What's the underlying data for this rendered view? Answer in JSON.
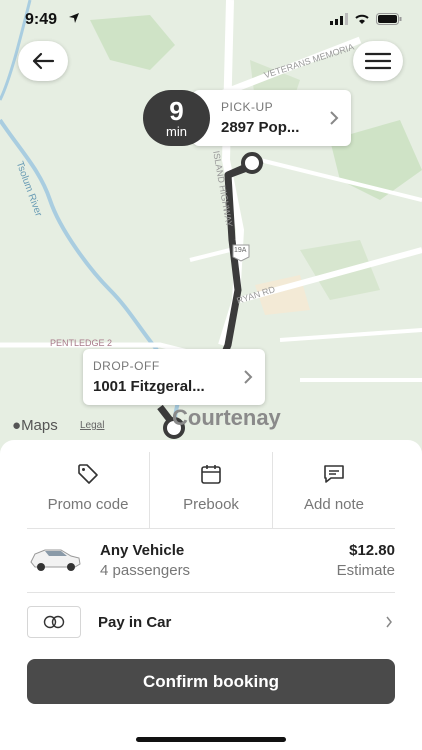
{
  "status_bar": {
    "time": "9:49"
  },
  "map": {
    "labels": {
      "river": "Tsolum River",
      "road1": "VETERANS MEMORIA",
      "road2": "RYAN RD",
      "road3": "ISLAND HIGHWAY",
      "area": "PENTLEDGE 2",
      "shield": "19A",
      "city": "Courtenay"
    },
    "attribution": {
      "maps": "Maps",
      "legal": "Legal"
    }
  },
  "pickup": {
    "eta_value": "9",
    "eta_unit": "min",
    "label": "PICK-UP",
    "address": "2897 Pop..."
  },
  "dropoff": {
    "label": "DROP-OFF",
    "address": "1001 Fitzgeral..."
  },
  "actions": [
    {
      "label": "Promo code",
      "icon": "tag-icon"
    },
    {
      "label": "Prebook",
      "icon": "calendar-icon"
    },
    {
      "label": "Add note",
      "icon": "note-icon"
    }
  ],
  "vehicle": {
    "name": "Any Vehicle",
    "passengers": "4 passengers",
    "price": "$12.80",
    "price_note": "Estimate"
  },
  "payment": {
    "label": "Pay in Car"
  },
  "confirm_label": "Confirm booking"
}
